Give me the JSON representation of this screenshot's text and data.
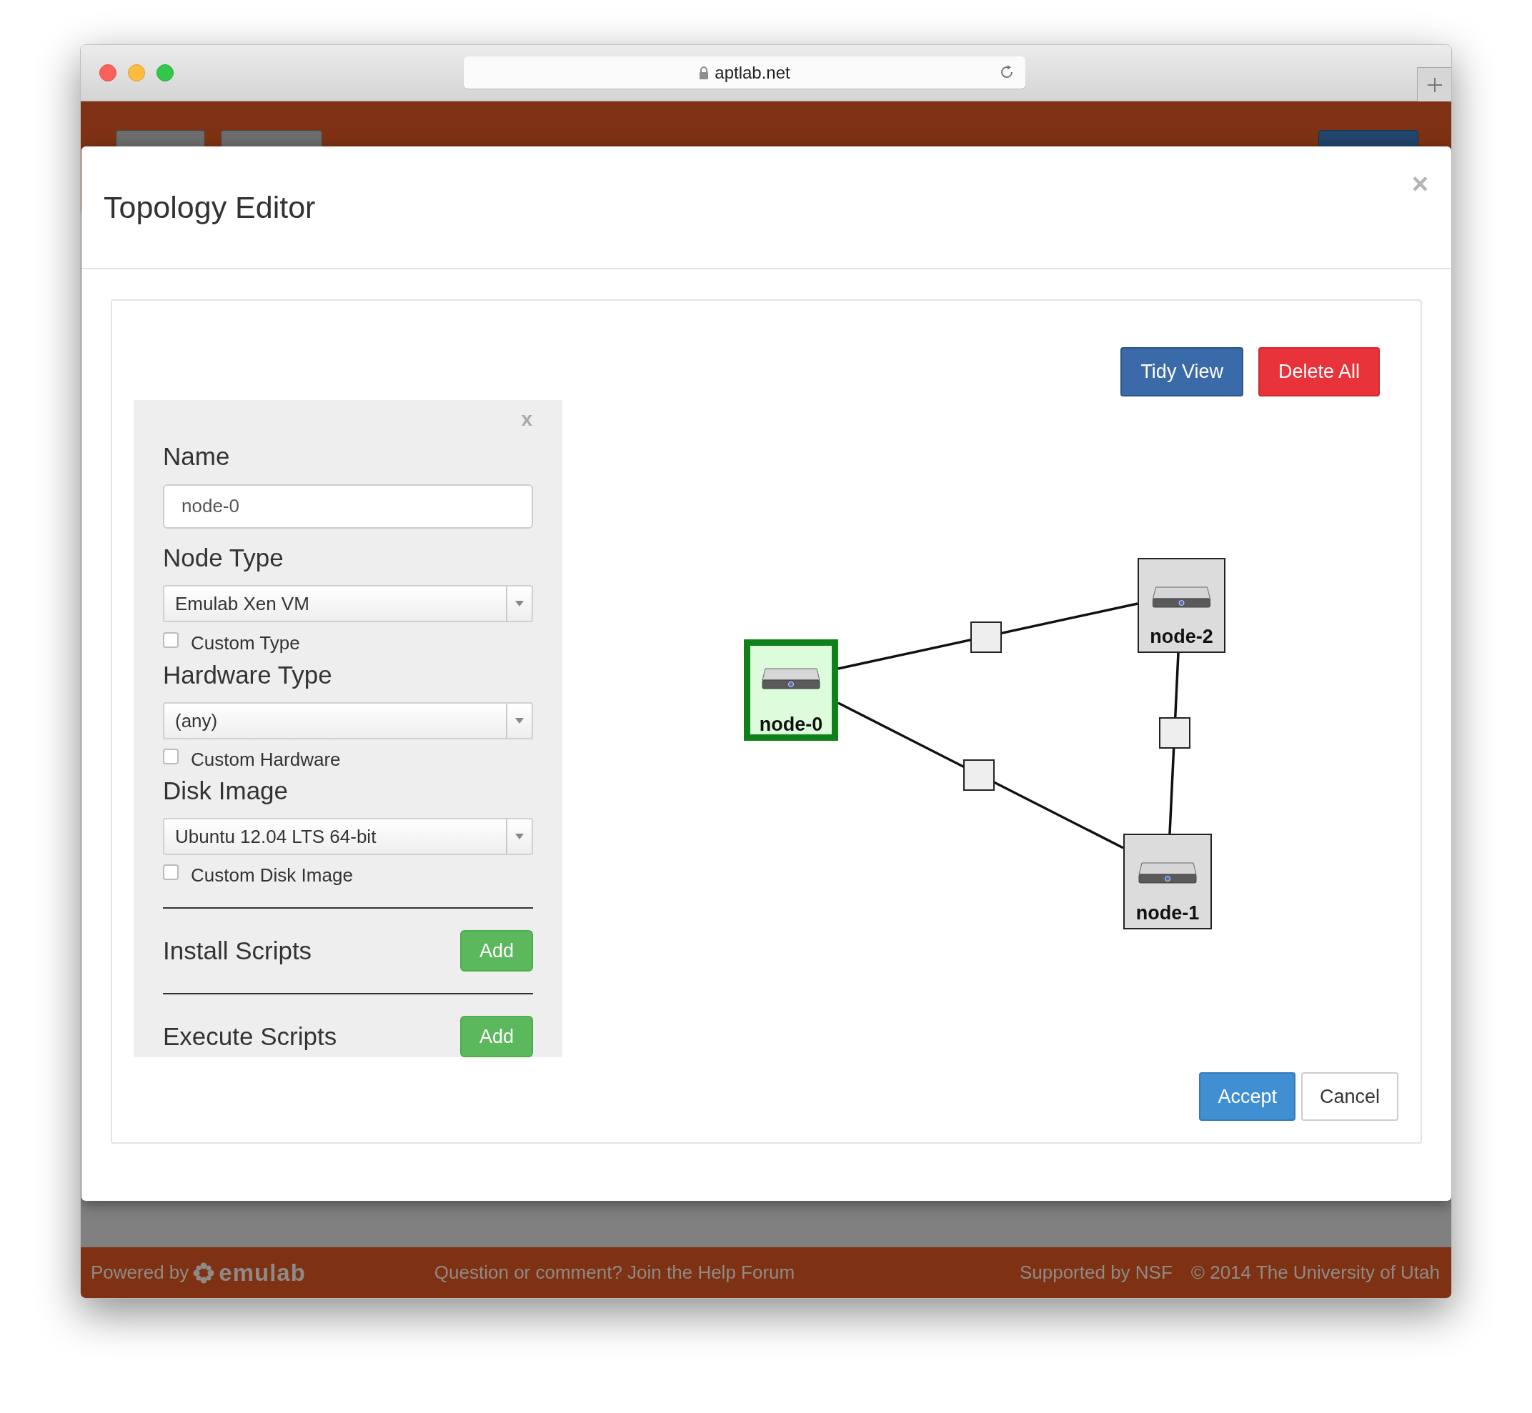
{
  "browser": {
    "url": "aptlab.net"
  },
  "modal": {
    "title": "Topology Editor",
    "close": "×"
  },
  "toolbar": [
    {
      "label": "Tidy View",
      "kind": "primary"
    },
    {
      "label": "Delete All",
      "kind": "danger"
    }
  ],
  "node_panel": {
    "close": "x",
    "fields": [
      {
        "kind": "text",
        "label": "Name",
        "value": "node-0"
      },
      {
        "kind": "select",
        "label": "Node Type",
        "value": "Emulab Xen VM",
        "custom": {
          "label": "Custom Type",
          "checked": false
        }
      },
      {
        "kind": "select",
        "label": "Hardware Type",
        "value": "(any)",
        "custom": {
          "label": "Custom Hardware",
          "checked": false
        }
      },
      {
        "kind": "select",
        "label": "Disk Image",
        "value": "Ubuntu 12.04 LTS 64-bit",
        "custom": {
          "label": "Custom Disk Image",
          "checked": false
        }
      }
    ],
    "scripts": [
      {
        "label": "Install Scripts",
        "button": "Add"
      },
      {
        "label": "Execute Scripts",
        "button": "Add"
      }
    ]
  },
  "nodes": [
    {
      "name": "node-0",
      "selected": true
    },
    {
      "name": "node-2",
      "selected": false
    },
    {
      "name": "node-1",
      "selected": false
    }
  ],
  "dialog_buttons": [
    {
      "label": "Accept",
      "kind": "primary"
    },
    {
      "label": "Cancel",
      "kind": "default"
    }
  ],
  "page_footer": {
    "powered_by": "Powered by",
    "logo": "emulab",
    "help": "Question or comment? Join the Help Forum",
    "supported": "Supported by NSF",
    "copyright": "© 2014 The University of Utah"
  }
}
